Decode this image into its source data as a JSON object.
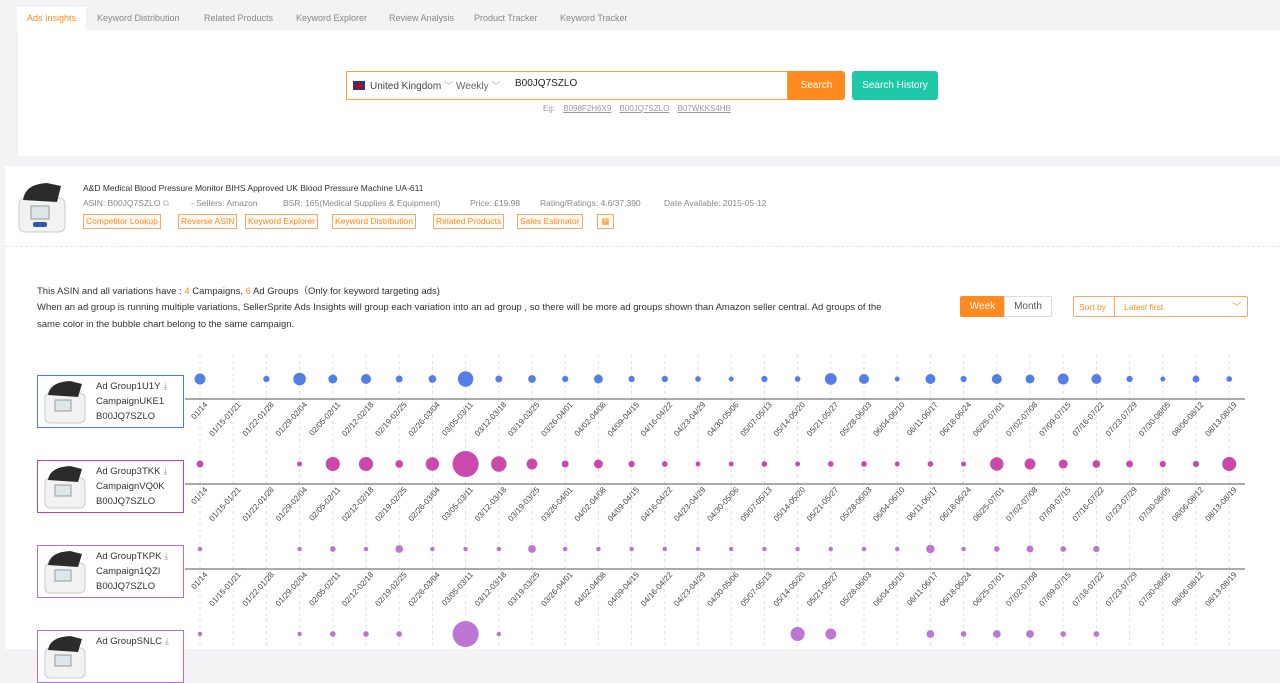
{
  "tabs": [
    "Ads Insights",
    "Keyword Distribution",
    "Related Products",
    "Keyword Explorer",
    "Review Analysis",
    "Product Tracker",
    "Keyword Tracker"
  ],
  "search": {
    "country": "United Kingdom",
    "period": "Weekly",
    "value": "B00JQ7SZLO",
    "search_label": "Search",
    "history_label": "Search History",
    "eg_label": "Eg:",
    "examples": [
      "B098F2H6X9",
      "B00JQ7SZLO",
      "B07WKKS4HB"
    ]
  },
  "product": {
    "title": "A&D Medical Blood Pressure Monitor BIHS Approved UK Blood Pressure Machine UA-611",
    "asin": "ASIN: B00JQ7SZLO",
    "sellers": "- Sellers: Amazon",
    "bsr": "BSR: 165(Medical Supplies & Equipment)",
    "price": "Price: £19.98",
    "rating": "Rating/Ratings: 4.6/37,390",
    "date": "Date Available: 2015-05-12",
    "actions": [
      "Competitor Lookup",
      "Reverse ASIN",
      "Keyword Explorer",
      "Keyword Distribution",
      "Related Products",
      "Sales Estimator"
    ]
  },
  "summary": {
    "line1_prefix": "This ASIN and all variations have :",
    "campaigns_count": "4",
    "campaigns_label": "Campaigns,",
    "groups_count": "6",
    "groups_label": "Ad Groups（Only for keyword targeting ads)",
    "line2": "When an ad group is running multiple variations, SellerSprite Ads Insights will group each variation into an ad group , so there will be more ad groups shown than Amazon seller central. Ad groups of the same color in the bubble chart belong to the same campaign."
  },
  "controls": {
    "week": "Week",
    "month": "Month",
    "sort_label": "Sort by",
    "sort_value": "Latest first"
  },
  "ad_groups": [
    {
      "name": "Ad Group1U1Y",
      "campaign": "CampaignUKE1",
      "asin": "B00JQ7SZLO",
      "color": "#4a78e6"
    },
    {
      "name": "Ad Group3TKK",
      "campaign": "CampaignVQ0K",
      "asin": "B00JQ7SZLO",
      "color": "#c83ea8"
    },
    {
      "name": "Ad GroupTKPK",
      "campaign": "Campaign1QZI",
      "asin": "B00JQ7SZLO",
      "color": "#b96fd1"
    },
    {
      "name": "Ad GroupSNLC",
      "campaign": "",
      "asin": "",
      "color": "#b96fd1"
    }
  ],
  "chart_data": {
    "type": "scatter",
    "x": [
      "01/08-01/14",
      "01/15-01/21",
      "01/22-01/28",
      "01/29-02/04",
      "02/05-02/11",
      "02/12-02/18",
      "02/19-02/25",
      "02/26-03/04",
      "03/05-03/11",
      "03/12-03/18",
      "03/19-03/25",
      "03/26-04/01",
      "04/02-04/08",
      "04/09-04/15",
      "04/16-04/22",
      "04/23-04/29",
      "04/30-05/06",
      "05/07-05/13",
      "05/14-05/20",
      "05/21-05/27",
      "05/28-06/03",
      "06/04-06/10",
      "06/11-06/17",
      "06/18-06/24",
      "06/25-07/01",
      "07/02-07/08",
      "07/09-07/15",
      "07/16-07/22",
      "07/23-07/29",
      "07/30-08/05",
      "08/06-08/12",
      "08/13-08/19"
    ],
    "x_tick_labels": [
      "01/14",
      "01/15-01/21",
      "01/22-01/28",
      "01/29-02/04",
      "02/05-02/11",
      "02/12-02/18",
      "02/19-02/25",
      "02/26-03/04",
      "03/05-03/11",
      "03/12-03/18",
      "03/19-03/25",
      "03/26-04/01",
      "04/02-04/08",
      "04/09-04/15",
      "04/16-04/22",
      "04/23-04/29",
      "04/30-05/06",
      "05/07-05/13",
      "05/14-05/20",
      "05/21-05/27",
      "05/28-06/03",
      "06/04-06/10",
      "06/11-06/17",
      "06/18-06/24",
      "06/25-07/01",
      "07/02-07/08",
      "07/09-07/15",
      "07/16-07/22",
      "07/23-07/29",
      "07/30-08/05",
      "08/06-08/12",
      "08/13-08/19"
    ],
    "series": [
      {
        "name": "Ad Group1U1Y",
        "values": [
          3,
          0,
          1,
          4,
          2,
          2.5,
          1.2,
          1.5,
          6,
          1.2,
          1.5,
          1,
          2,
          1,
          1,
          0.8,
          0.6,
          1,
          0.8,
          3.5,
          2.5,
          0.6,
          2.5,
          1,
          2.5,
          2,
          3,
          2.5,
          1,
          0.6,
          1.2,
          0.8
        ]
      },
      {
        "name": "Ad Group3TKK",
        "values": [
          1.2,
          0,
          0,
          0.6,
          5,
          5,
          1.5,
          4.5,
          17,
          6,
          3,
          1.2,
          2,
          1,
          0.8,
          0.6,
          0.6,
          0.8,
          0.6,
          0.8,
          0.8,
          0.6,
          0.8,
          0.6,
          4.5,
          3,
          2,
          1.5,
          1.2,
          1,
          1,
          5
        ]
      },
      {
        "name": "Ad GroupTKPK",
        "values": [
          0.5,
          0,
          0,
          0.5,
          0.8,
          0.5,
          1.5,
          0.5,
          0.5,
          0.5,
          1.5,
          0.5,
          0.5,
          0.5,
          0.5,
          0.5,
          0.5,
          0.5,
          0.5,
          0.5,
          0.5,
          0.5,
          1.8,
          0.5,
          0.8,
          1.2,
          0.8,
          1,
          0,
          0,
          0,
          0
        ]
      },
      {
        "name": "Ad GroupSNLC",
        "values": [
          0.5,
          0,
          0,
          0.5,
          0.8,
          0.8,
          0.8,
          0,
          17,
          0.5,
          0,
          0,
          0,
          0,
          0,
          0,
          0,
          0,
          5,
          3,
          0,
          0,
          1.5,
          0.8,
          1.5,
          1.5,
          0.8,
          0.8,
          0,
          0,
          0,
          0
        ]
      }
    ]
  }
}
